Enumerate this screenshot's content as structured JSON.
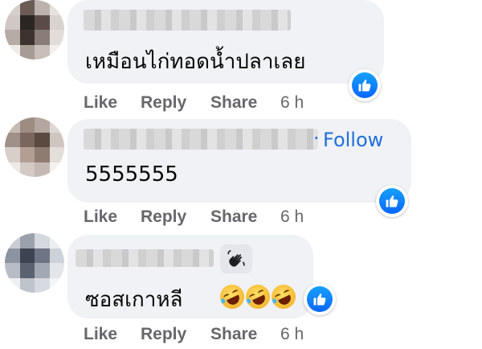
{
  "comments": [
    {
      "text": "เหมือนไก่ทอดน้ำปลาเลย",
      "follow_label": "",
      "reaction": "like-icon",
      "actions": {
        "like": "Like",
        "reply": "Reply",
        "share": "Share",
        "time": "6 h"
      }
    },
    {
      "text": "5555555",
      "follow_label": "Follow",
      "reaction": "like-icon",
      "actions": {
        "like": "Like",
        "reply": "Reply",
        "share": "Share",
        "time": "6 h"
      }
    },
    {
      "text": "ซอสเกาหลี",
      "follow_label": "",
      "badge": "waving-hand-icon",
      "emojis": [
        "rolling-laughing-emoji",
        "rolling-laughing-emoji",
        "rolling-laughing-emoji"
      ],
      "reaction": "like-icon",
      "actions": {
        "like": "Like",
        "reply": "Reply",
        "share": "Share",
        "time": "6 h"
      }
    }
  ],
  "colors": {
    "bubble": "#f0f2f5",
    "link": "#216fdb",
    "action": "#65676b",
    "like": "#0866ff"
  }
}
